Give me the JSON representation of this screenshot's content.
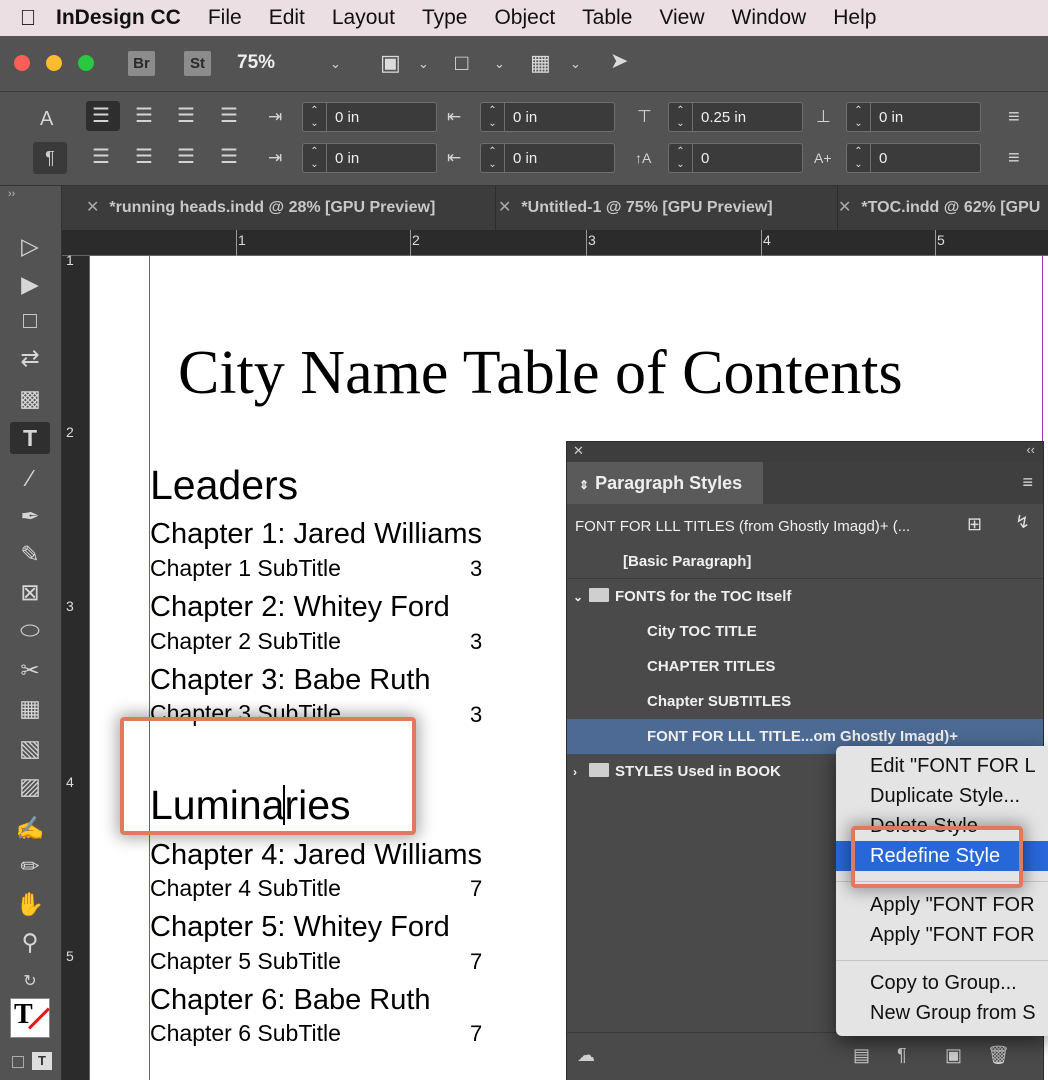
{
  "menubar": {
    "apple": "",
    "app_name": "InDesign CC",
    "items": [
      "File",
      "Edit",
      "Layout",
      "Type",
      "Object",
      "Table",
      "View",
      "Window",
      "Help"
    ]
  },
  "appbar": {
    "bridge": "Br",
    "stock": "St",
    "zoom": "75%"
  },
  "control": {
    "left_indent": "0 in",
    "right_indent": "0 in",
    "space_before": "0.25 in",
    "space_after": "0 in",
    "first_indent": "0 in",
    "last_indent": "0 in",
    "dropcap_lines": "0",
    "dropcap_chars": "0"
  },
  "tabs": [
    {
      "label": "*running heads.indd @ 28% [GPU Preview]"
    },
    {
      "label": "*Untitled-1 @ 75% [GPU Preview]"
    },
    {
      "label": "*TOC.indd @ 62% [GPU"
    }
  ],
  "rulers": {
    "h": [
      "1",
      "2",
      "3",
      "4",
      "5"
    ],
    "v": [
      "1",
      "2",
      "3",
      "4",
      "5"
    ]
  },
  "document": {
    "title": "City Name Table of Contents",
    "leaders_heading": "Leaders",
    "luminaries_before": "Lumina",
    "luminaries_after": "ries",
    "chapters": [
      {
        "title": "Chapter 1: Jared Williams",
        "subtitle": "Chapter 1 SubTitle",
        "page": "3"
      },
      {
        "title": "Chapter 2: Whitey Ford",
        "subtitle": "Chapter 2 SubTitle",
        "page": "3"
      },
      {
        "title": "Chapter 3: Babe Ruth",
        "subtitle": "Chapter 3 SubTitle",
        "page": "3"
      },
      {
        "title": "Chapter 4: Jared Williams",
        "subtitle": "Chapter 4 SubTitle",
        "page": "7"
      },
      {
        "title": "Chapter 5: Whitey Ford",
        "subtitle": "Chapter 5 SubTitle",
        "page": "7"
      },
      {
        "title": "Chapter 6: Babe Ruth",
        "subtitle": "Chapter 6 SubTitle",
        "page": "7"
      }
    ]
  },
  "panel": {
    "title": "Paragraph Styles",
    "current_style": "FONT FOR LLL TITLES (from Ghostly Imagd)+ (...",
    "rows": [
      {
        "label": "[Basic Paragraph]"
      },
      {
        "label": "FONTS for the TOC Itself"
      },
      {
        "label": "City TOC TITLE"
      },
      {
        "label": "CHAPTER TITLES"
      },
      {
        "label": "Chapter SUBTITLES"
      },
      {
        "label": "FONT FOR LLL TITLE...om Ghostly Imagd)+"
      },
      {
        "label": "STYLES Used in BOOK"
      }
    ]
  },
  "context_menu": {
    "items": [
      "Edit \"FONT FOR L",
      "Duplicate Style...",
      "Delete Style",
      "Redefine Style",
      "Apply \"FONT FOR",
      "Apply \"FONT FOR",
      "Copy to Group...",
      "New Group from S"
    ]
  },
  "colors": {
    "highlight_box": "#e07a5f",
    "menu_hover": "#2867d8",
    "panel_selection": "#4c6a93",
    "margin_guide": "#a23db0"
  },
  "icons": [
    "apple-icon",
    "selection-tool-icon",
    "direct-selection-tool-icon",
    "page-tool-icon",
    "gap-tool-icon",
    "content-collector-icon",
    "type-tool-icon",
    "line-tool-icon",
    "pen-tool-icon",
    "pencil-tool-icon",
    "rectangle-frame-icon",
    "ellipse-tool-icon",
    "scissors-icon",
    "free-transform-icon",
    "gradient-swatch-icon",
    "gradient-feather-icon",
    "note-tool-icon",
    "eyedropper-icon",
    "hand-tool-icon",
    "zoom-tool-icon",
    "cloud-icon",
    "folder-icon",
    "trash-icon"
  ]
}
